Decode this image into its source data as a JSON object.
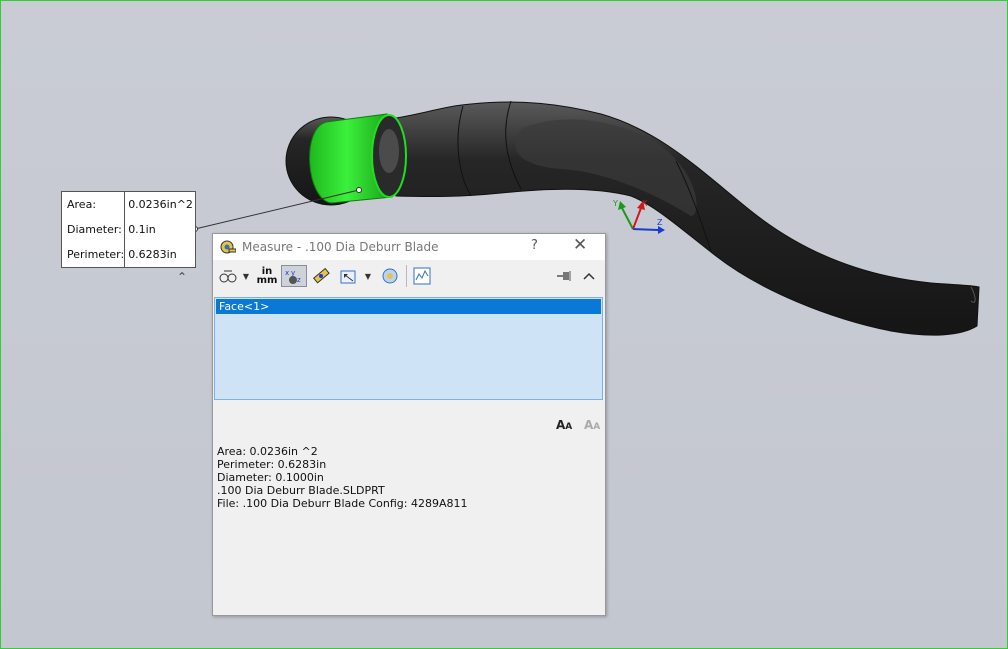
{
  "callout": {
    "rows": [
      {
        "label": "Area:",
        "value": "0.0236in^2"
      },
      {
        "label": "Diameter:",
        "value": "0.1in"
      },
      {
        "label": "Perimeter:",
        "value": "0.6283in"
      }
    ],
    "collapse_glyph": "⌃"
  },
  "dialog": {
    "title": "Measure - .100 Dia Deburr Blade",
    "help": "?",
    "close": "✕",
    "units_top": "in",
    "units_bottom": "mm",
    "selection": [
      "Face<1>"
    ],
    "results": [
      "Area: 0.0236in ^2",
      "Perimeter: 0.6283in",
      "Diameter: 0.1000in",
      ".100 Dia Deburr Blade.SLDPRT",
      "File: .100 Dia Deburr Blade Config: 4289A811"
    ]
  },
  "triad": {
    "x": "X",
    "y": "Y",
    "z": "Z"
  },
  "colors": {
    "selected_face": "#1ee01e",
    "part": "#2b2b2b",
    "viewport_border": "#2fd02f"
  }
}
